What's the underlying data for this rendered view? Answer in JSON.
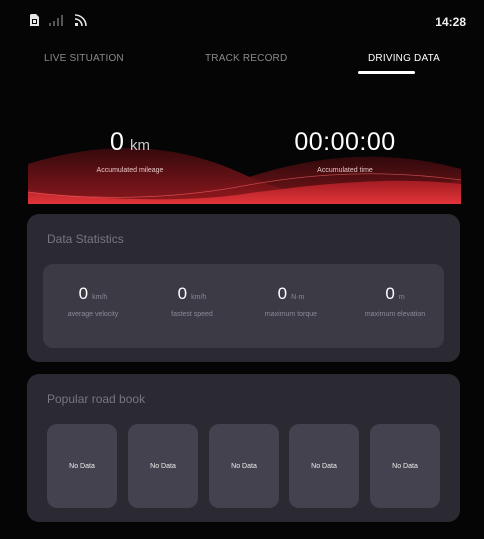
{
  "status_bar": {
    "icons": [
      "sim-card-icon",
      "signal-icon",
      "cast-icon"
    ],
    "time": "14:28"
  },
  "tabs": [
    {
      "label": "LIVE SITUATION",
      "active": false
    },
    {
      "label": "TRACK RECORD",
      "active": false
    },
    {
      "label": "DRIVING DATA",
      "active": true
    }
  ],
  "hero": {
    "mileage": {
      "value": "0",
      "unit": "km",
      "label": "Accumulated mileage"
    },
    "time": {
      "value": "00:00:00",
      "label": "Accumulated time"
    }
  },
  "data_statistics": {
    "title": "Data Statistics",
    "items": [
      {
        "value": "0",
        "unit": "km/h",
        "label": "average velocity"
      },
      {
        "value": "0",
        "unit": "km/h",
        "label": "fastest speed"
      },
      {
        "value": "0",
        "unit": "N·m",
        "label": "maximum torque"
      },
      {
        "value": "0",
        "unit": "m",
        "label": "maximum elevation"
      }
    ]
  },
  "road_book": {
    "title": "Popular road book",
    "items": [
      {
        "label": "No Data"
      },
      {
        "label": "No Data"
      },
      {
        "label": "No Data"
      },
      {
        "label": "No Data"
      },
      {
        "label": "No Data"
      }
    ]
  },
  "colors": {
    "background": "#050505",
    "card": "#2b2a33",
    "card_inner": "#3b3a45",
    "wave_red": "#c8262b",
    "wave_dark": "#5e1015"
  }
}
